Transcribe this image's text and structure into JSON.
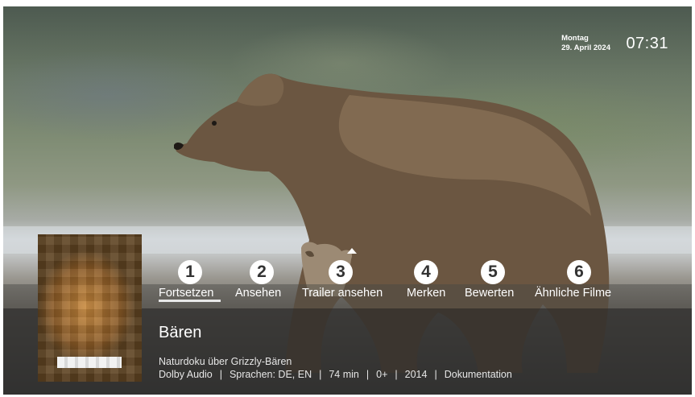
{
  "datetime": {
    "weekday": "Montag",
    "date": "29. April 2024",
    "time": "07:31"
  },
  "actions": [
    {
      "number": "1",
      "label": "Fortsetzen",
      "selected": true
    },
    {
      "number": "2",
      "label": "Ansehen"
    },
    {
      "number": "3",
      "label": "Trailer ansehen"
    },
    {
      "number": "4",
      "label": "Merken"
    },
    {
      "number": "5",
      "label": "Bewerten"
    },
    {
      "number": "6",
      "label": "Ähnliche Filme"
    }
  ],
  "movie": {
    "title": "Bären",
    "description": "Naturdoku über Grizzly-Bären",
    "meta": [
      "Dolby Audio",
      "Sprachen: DE, EN",
      "74 min",
      "0+",
      "2014",
      "Dokumentation"
    ]
  }
}
